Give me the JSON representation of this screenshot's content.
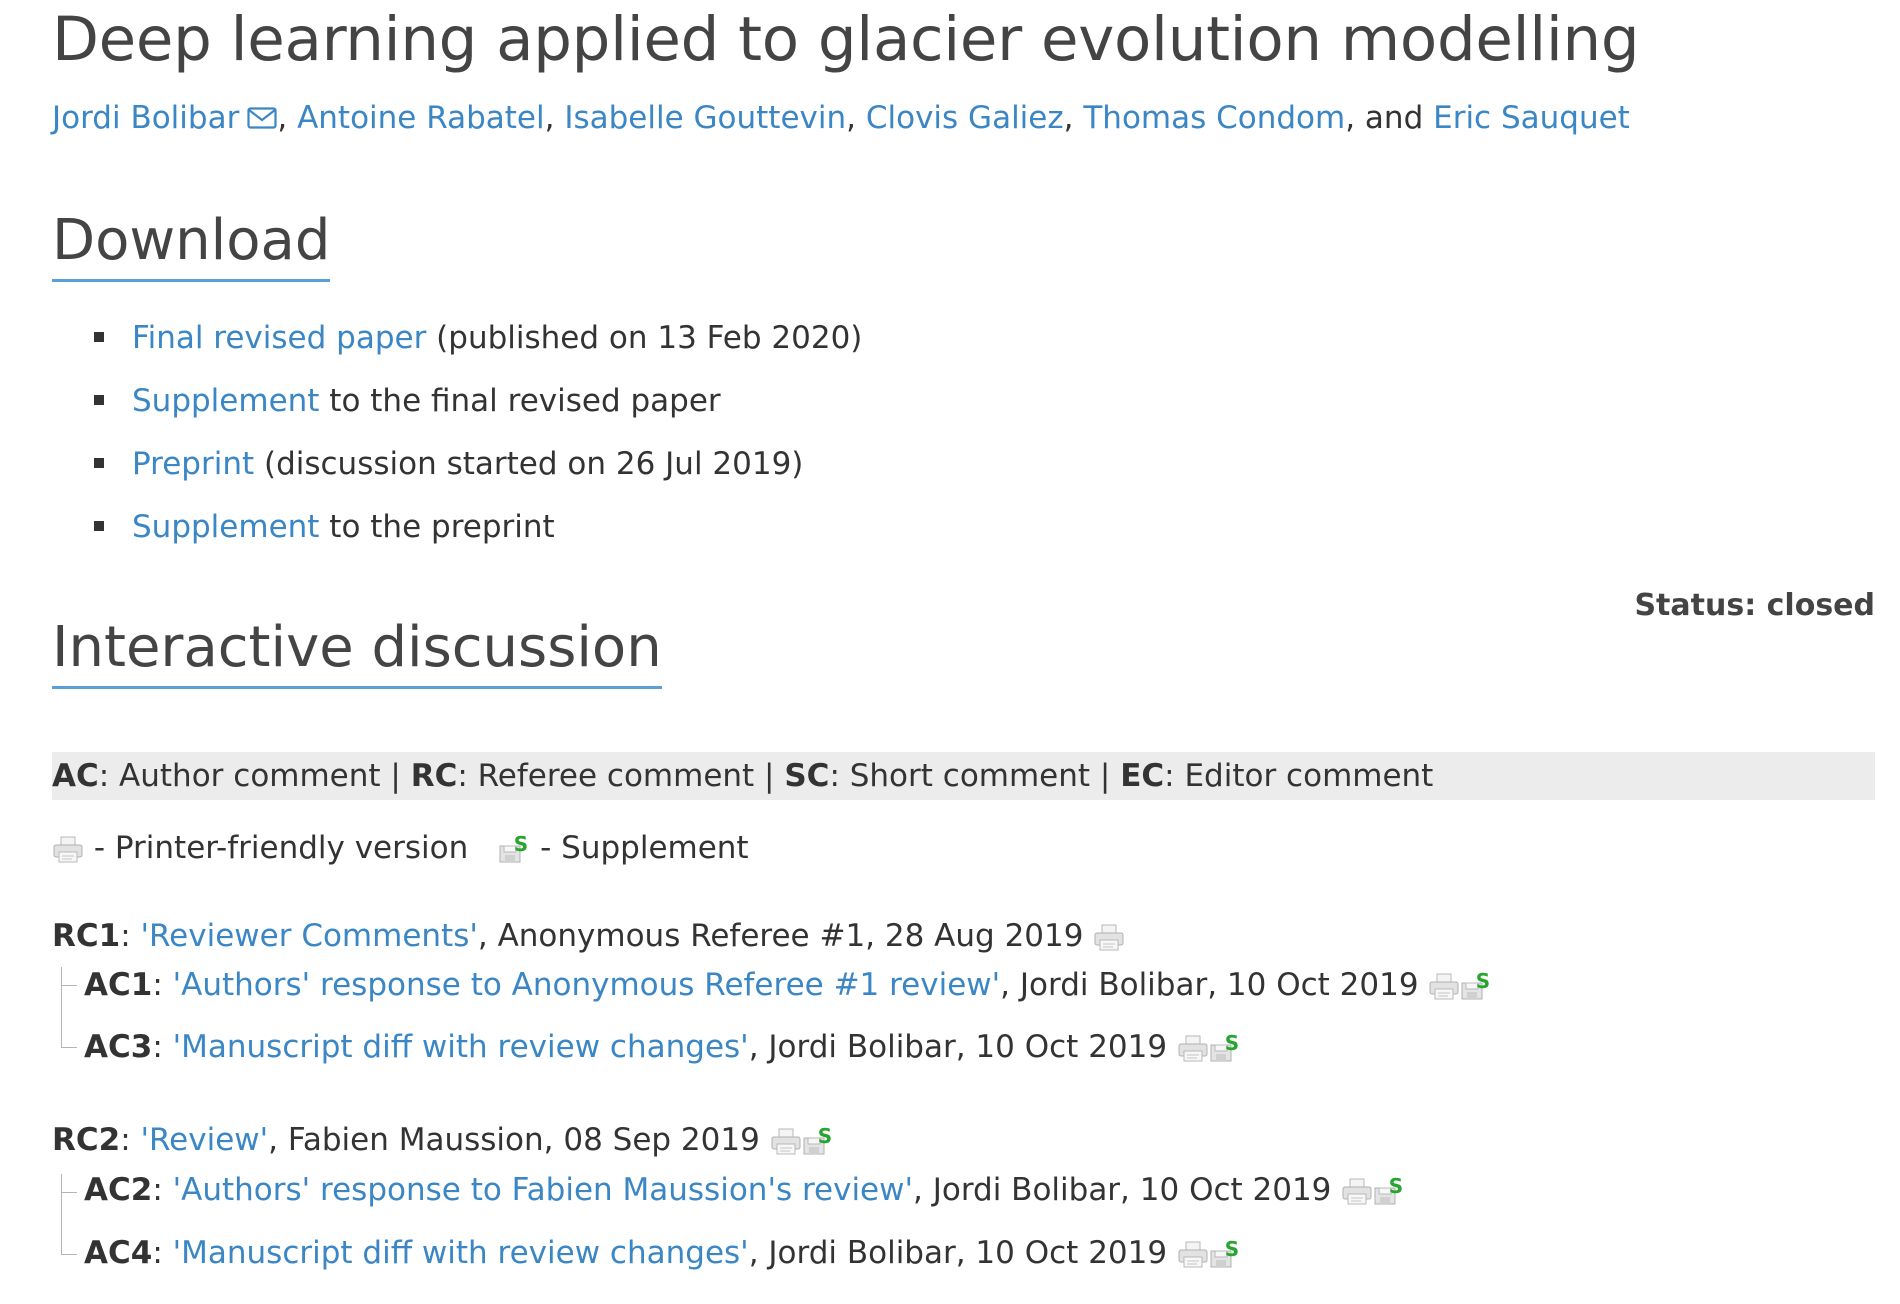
{
  "title": "Deep learning applied to glacier evolution modelling",
  "authors": [
    {
      "name": "Jordi Bolibar",
      "sep": ", "
    },
    {
      "name": "Antoine Rabatel",
      "sep": ", "
    },
    {
      "name": "Isabelle Gouttevin",
      "sep": ", "
    },
    {
      "name": "Clovis Galiez",
      "sep": ", "
    },
    {
      "name": "Thomas Condom",
      "sep": ", and "
    },
    {
      "name": "Eric Sauquet",
      "sep": ""
    }
  ],
  "download": {
    "heading": "Download",
    "items": [
      {
        "link": "Final revised paper",
        "text": " (published on 13 Feb 2020)"
      },
      {
        "link": "Supplement",
        "text": " to the final revised paper"
      },
      {
        "link": "Preprint",
        "text": " (discussion started on 26 Jul 2019)"
      },
      {
        "link": "Supplement",
        "text": " to the preprint"
      }
    ]
  },
  "status": "Status: closed",
  "discussion": {
    "heading": "Interactive discussion",
    "legend": [
      {
        "code": "AC",
        "label": ": Author comment",
        "sep": " | "
      },
      {
        "code": "RC",
        "label": ": Referee comment",
        "sep": " | "
      },
      {
        "code": "SC",
        "label": ": Short comment",
        "sep": " | "
      },
      {
        "code": "EC",
        "label": ": Editor comment",
        "sep": ""
      }
    ],
    "icon_legend": {
      "printer": " - Printer-friendly version",
      "supplement": " - Supplement"
    },
    "comments": {
      "rc1": {
        "code": "RC1",
        "title": "'Reviewer Comments'",
        "meta": ", Anonymous Referee #1, 28 Aug 2019"
      },
      "ac1": {
        "code": "AC1",
        "title": "'Authors' response to Anonymous Referee #1 review'",
        "meta": ", Jordi Bolibar, 10 Oct 2019"
      },
      "ac3": {
        "code": "AC3",
        "title": "'Manuscript diff with review changes'",
        "meta": ", Jordi Bolibar, 10 Oct 2019"
      },
      "rc2": {
        "code": "RC2",
        "title": "'Review'",
        "meta": ", Fabien Maussion, 08 Sep 2019"
      },
      "ac2": {
        "code": "AC2",
        "title": "'Authors' response to Fabien Maussion's review'",
        "meta": ", Jordi Bolibar, 10 Oct 2019"
      },
      "ac4": {
        "code": "AC4",
        "title": "'Manuscript diff with review changes'",
        "meta": ", Jordi Bolibar, 10 Oct 2019"
      }
    }
  },
  "colors": {
    "link": "#3b86c5",
    "heading_underline": "#5aa0d8",
    "legend_bg": "#ececec",
    "supplement_s": "#27a52f"
  },
  "icons": {
    "mail": "envelope-icon",
    "printer": "printer-icon",
    "supplement": "supplement-icon"
  }
}
